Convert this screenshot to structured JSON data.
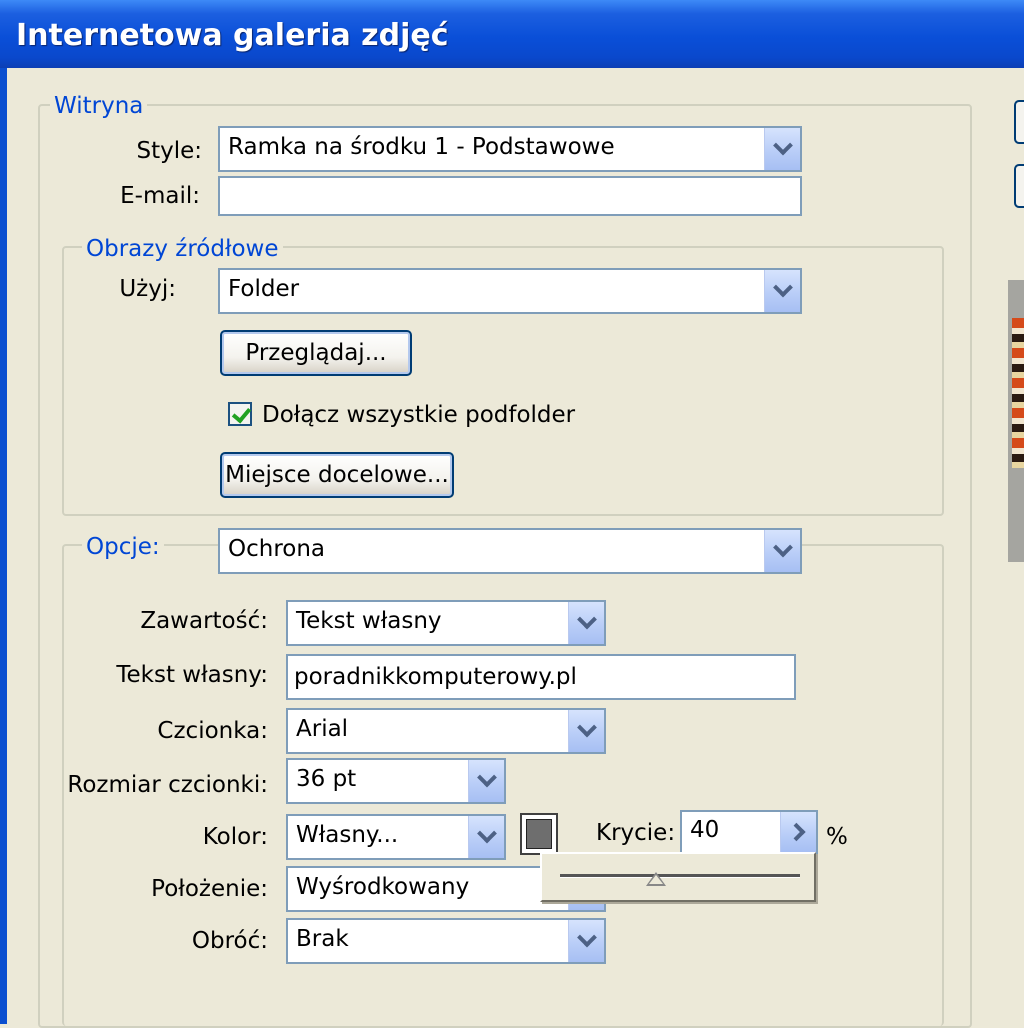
{
  "window": {
    "title": "Internetowa galeria zdjęć"
  },
  "witryna": {
    "legend": "Witryna",
    "style_label": "Style:",
    "style_value": "Ramka na środku 1 - Podstawowe",
    "email_label": "E-mail:",
    "email_value": ""
  },
  "source": {
    "legend": "Obrazy źródłowe",
    "use_label": "Użyj:",
    "use_value": "Folder",
    "browse_button": "Przeglądaj...",
    "include_subfolders_label": "Dołącz wszystkie podfolder",
    "include_subfolders_checked": true,
    "destination_button": "Miejsce docelowe..."
  },
  "options": {
    "legend": "Opcje:",
    "section_value": "Ochrona",
    "content_label": "Zawartość:",
    "content_value": "Tekst własny",
    "custom_text_label": "Tekst własny:",
    "custom_text_value": "poradnikkomputerowy.pl",
    "font_label": "Czcionka:",
    "font_value": "Arial",
    "font_size_label": "Rozmiar czcionki:",
    "font_size_value": "36 pt",
    "color_label": "Kolor:",
    "color_value": "Własny...",
    "color_swatch": "#6e6e6e",
    "opacity_label": "Krycie:",
    "opacity_value": "40",
    "opacity_unit": "%",
    "opacity_fraction": 0.4,
    "position_label": "Położenie:",
    "position_value": "Wyśrodkowany",
    "rotate_label": "Obróć:",
    "rotate_value": "Brak"
  },
  "colors": {
    "accent": "#0046d5",
    "titlebar": "#0a4fd8",
    "face": "#ece9d8"
  }
}
